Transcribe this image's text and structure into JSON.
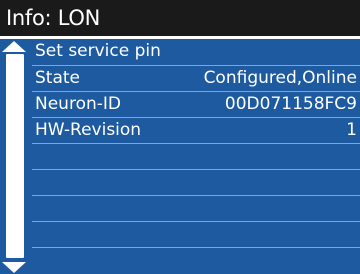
{
  "title": "Info: LON",
  "menu": {
    "rows": [
      {
        "label": "Set service pin",
        "value": ""
      },
      {
        "label": "State",
        "value": "Configured,Online"
      },
      {
        "label": "Neuron-ID",
        "value": "00D071158FC9"
      },
      {
        "label": "HW-Revision",
        "value": "1"
      },
      {
        "label": "",
        "value": ""
      },
      {
        "label": "",
        "value": ""
      },
      {
        "label": "",
        "value": ""
      },
      {
        "label": "",
        "value": ""
      },
      {
        "label": "",
        "value": ""
      }
    ]
  },
  "colors": {
    "title_bg": "#1a1a1a",
    "list_bg": "#1e5aa0",
    "separator": "#7fa6d2",
    "text": "#ffffff"
  },
  "icons": {
    "scroll_up": "triangle-up",
    "scroll_down": "triangle-down"
  }
}
